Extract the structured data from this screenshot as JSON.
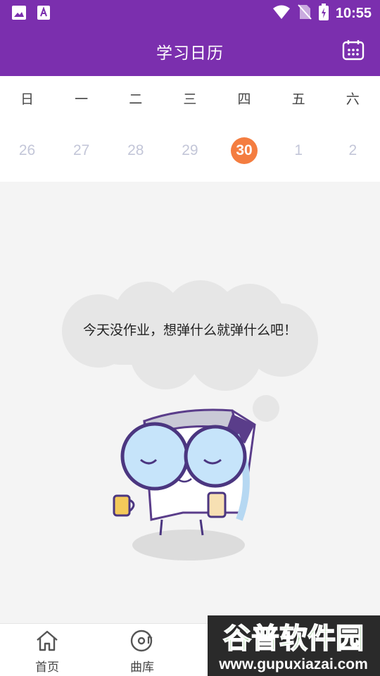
{
  "status_bar": {
    "time": "10:55",
    "icons": [
      "image-icon",
      "font-icon",
      "wifi-icon",
      "no-sim-icon",
      "battery-charging-icon"
    ]
  },
  "header": {
    "title": "学习日历",
    "calendar_button_icon": "calendar-icon"
  },
  "calendar": {
    "weekdays": [
      "日",
      "一",
      "二",
      "三",
      "四",
      "五",
      "六"
    ],
    "dates": [
      "26",
      "27",
      "28",
      "29",
      "30",
      "1",
      "2"
    ],
    "selected_index": 4
  },
  "empty_state": {
    "message": "今天没作业，想弹什么就弹什么吧！"
  },
  "tabs": [
    {
      "label": "首页",
      "icon": "home-icon"
    },
    {
      "label": "曲库",
      "icon": "music-disc-icon"
    }
  ],
  "watermark": {
    "brand": "谷普软件园",
    "url": "www.gupuxiazai.com"
  },
  "colors": {
    "primary": "#7b2fae",
    "selected_date": "#f47d40",
    "date_text": "#c3c6d8",
    "background": "#f4f4f4"
  }
}
